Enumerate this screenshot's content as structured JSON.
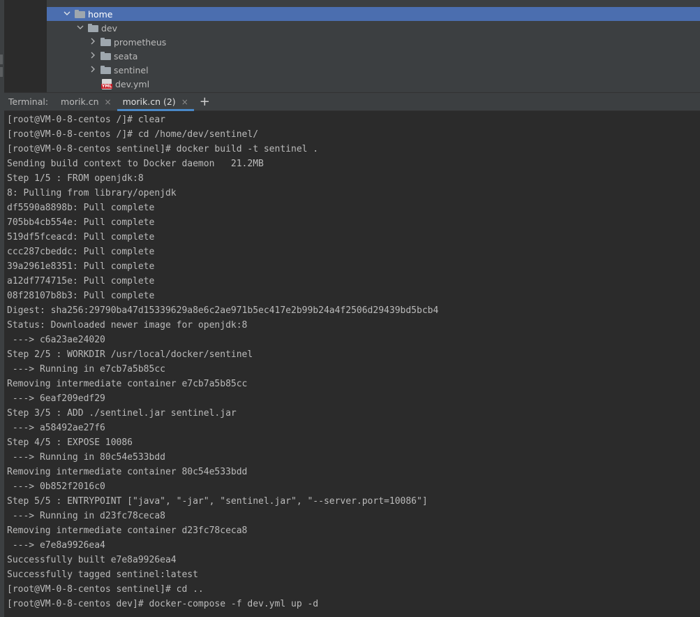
{
  "tree": {
    "items": [
      {
        "label": "home",
        "kind": "folder",
        "expanded": true,
        "selected": true
      },
      {
        "label": "dev",
        "kind": "folder",
        "expanded": true,
        "selected": false
      },
      {
        "label": "prometheus",
        "kind": "folder",
        "expanded": false,
        "selected": false
      },
      {
        "label": "seata",
        "kind": "folder",
        "expanded": false,
        "selected": false
      },
      {
        "label": "sentinel",
        "kind": "folder",
        "expanded": false,
        "selected": false
      },
      {
        "label": "dev.yml",
        "kind": "file",
        "icon": "yml-file-icon",
        "badge": "YML"
      }
    ]
  },
  "terminal": {
    "label": "Terminal:",
    "tabs": [
      {
        "label": "morik.cn",
        "close": "×",
        "active": false
      },
      {
        "label": "morik.cn (2)",
        "close": "×",
        "active": true
      }
    ],
    "add_label": "+",
    "lines": [
      "[root@VM-0-8-centos /]# clear",
      "[root@VM-0-8-centos /]# cd /home/dev/sentinel/",
      "[root@VM-0-8-centos sentinel]# docker build -t sentinel .",
      "Sending build context to Docker daemon   21.2MB",
      "Step 1/5 : FROM openjdk:8",
      "8: Pulling from library/openjdk",
      "df5590a8898b: Pull complete",
      "705bb4cb554e: Pull complete",
      "519df5fceacd: Pull complete",
      "ccc287cbeddc: Pull complete",
      "39a2961e8351: Pull complete",
      "a12df774715e: Pull complete",
      "08f28107b8b3: Pull complete",
      "Digest: sha256:29790ba47d15339629a8e6c2ae971b5ec417e2b99b24a4f2506d29439bd5bcb4",
      "Status: Downloaded newer image for openjdk:8",
      " ---> c6a23ae24020",
      "Step 2/5 : WORKDIR /usr/local/docker/sentinel",
      " ---> Running in e7cb7a5b85cc",
      "Removing intermediate container e7cb7a5b85cc",
      " ---> 6eaf209edf29",
      "Step 3/5 : ADD ./sentinel.jar sentinel.jar",
      " ---> a58492ae27f6",
      "Step 4/5 : EXPOSE 10086",
      " ---> Running in 80c54e533bdd",
      "Removing intermediate container 80c54e533bdd",
      " ---> 0b852f2016c0",
      "Step 5/5 : ENTRYPOINT [\"java\", \"-jar\", \"sentinel.jar\", \"--server.port=10086\"]",
      " ---> Running in d23fc78ceca8",
      "Removing intermediate container d23fc78ceca8",
      " ---> e7e8a9926ea4",
      "Successfully built e7e8a9926ea4",
      "Successfully tagged sentinel:latest",
      "[root@VM-0-8-centos sentinel]# cd ..",
      "[root@VM-0-8-centos dev]# docker-compose -f dev.yml up -d"
    ]
  },
  "colors": {
    "background": "#2b2b2b",
    "panel": "#3c3f41",
    "selection": "#4b6eaf",
    "accent": "#4a88c7",
    "text": "#bbbbbb"
  }
}
